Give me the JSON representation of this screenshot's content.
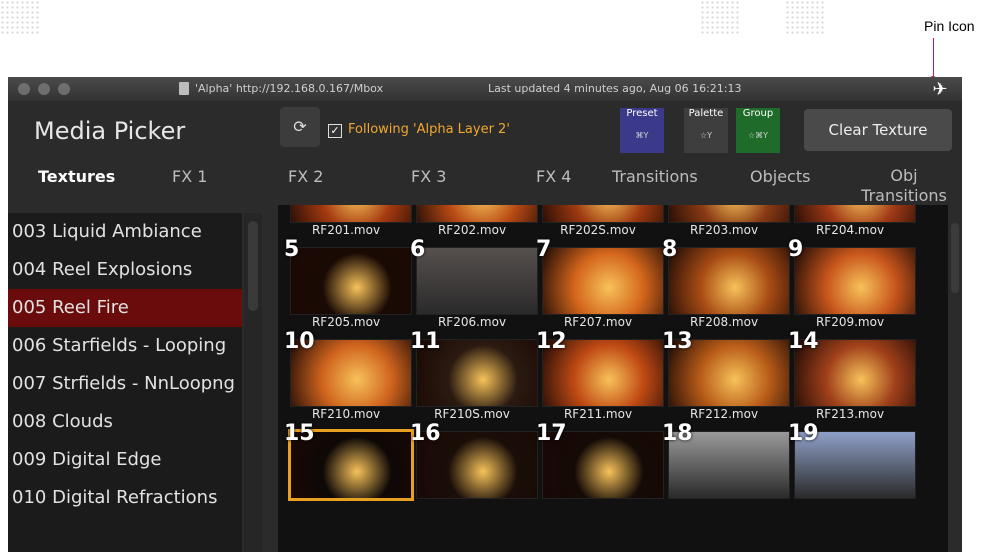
{
  "annotation": {
    "pin_label": "Pin Icon"
  },
  "titlebar": {
    "url": "'Alpha' http://192.168.0.167/Mbox",
    "updated": "Last updated 4 minutes ago, Aug 06 16:21:13"
  },
  "header": {
    "app_name": "Media Picker",
    "refresh_glyph": "⟳",
    "follow_label": "Following 'Alpha Layer 2'",
    "follow_checked_glyph": "✓",
    "modes": [
      {
        "label": "Preset",
        "shortcut": "⌘Y",
        "color": "#3b3a8a"
      },
      {
        "label": "Palette",
        "shortcut": "☆Y",
        "color": "#3e3e3e"
      },
      {
        "label": "Group",
        "shortcut": "☆⌘Y",
        "color": "#1f6b2a"
      }
    ],
    "clear_label": "Clear Texture"
  },
  "tabs": [
    "Textures",
    "FX 1",
    "FX 2",
    "FX 3",
    "FX 4",
    "Transitions",
    "Objects",
    "Obj Transitions"
  ],
  "sidebar": {
    "items": [
      "003 Liquid Ambiance",
      "004 Reel Explosions",
      "005 Reel Fire",
      "006 Starfields - Looping",
      "007 Strfields - NnLoopng",
      "008 Clouds",
      "009 Digital Edge",
      "010 Digital Refractions"
    ],
    "selected_index": 2
  },
  "grid": {
    "rows": [
      {
        "items": [
          {
            "num": "",
            "file": "RF201.mov",
            "bg": "#a53a10"
          },
          {
            "num": "",
            "file": "RF202.mov",
            "bg": "#b84a14"
          },
          {
            "num": "",
            "file": "RF202S.mov",
            "bg": "#9e3a10"
          },
          {
            "num": "",
            "file": "RF203.mov",
            "bg": "#8a3a14"
          },
          {
            "num": "",
            "file": "RF204.mov",
            "bg": "#a03a16"
          }
        ]
      },
      {
        "items": [
          {
            "num": "5",
            "file": "RF205.mov",
            "bg": "#1a0a04"
          },
          {
            "num": "6",
            "file": "RF206.mov",
            "bg": "#56504e"
          },
          {
            "num": "7",
            "file": "RF207.mov",
            "bg": "#d4661c"
          },
          {
            "num": "8",
            "file": "RF208.mov",
            "bg": "#a84c14"
          },
          {
            "num": "9",
            "file": "RF209.mov",
            "bg": "#c8561c"
          }
        ]
      },
      {
        "items": [
          {
            "num": "10",
            "file": "RF210.mov",
            "bg": "#d0641e"
          },
          {
            "num": "11",
            "file": "RF210S.mov",
            "bg": "#2a1a10"
          },
          {
            "num": "12",
            "file": "RF211.mov",
            "bg": "#c04a14"
          },
          {
            "num": "13",
            "file": "RF212.mov",
            "bg": "#b85c18"
          },
          {
            "num": "14",
            "file": "RF213.mov",
            "bg": "#a0401a"
          }
        ]
      },
      {
        "items": [
          {
            "num": "15",
            "file": "",
            "bg": "#0e0806"
          },
          {
            "num": "16",
            "file": "",
            "bg": "#1a0e08"
          },
          {
            "num": "17",
            "file": "",
            "bg": "#140a06"
          },
          {
            "num": "18",
            "file": "",
            "bg": "#9a9a9a"
          },
          {
            "num": "19",
            "file": "",
            "bg": "#8fa0c8"
          }
        ]
      }
    ],
    "selected": "15"
  },
  "colors": {
    "accent_orange": "#e8a020",
    "sidebar_selected": "#6b0c0c",
    "annotation": "#c2185b"
  }
}
